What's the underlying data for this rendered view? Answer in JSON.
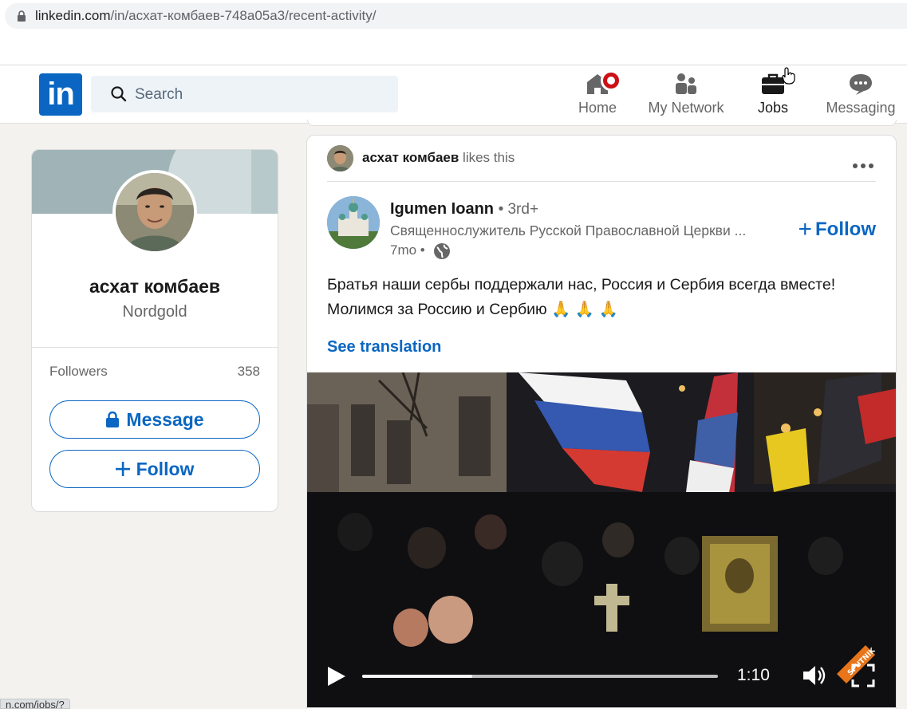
{
  "browser": {
    "url_host": "linkedin.com",
    "url_path": "/in/асхат-комбаев-748a05a3/recent-activity/",
    "status_bar_url": "n.com/jobs/?"
  },
  "navbar": {
    "logo": "in",
    "search_placeholder": "Search",
    "items": [
      {
        "label": "Home",
        "icon": "home-icon"
      },
      {
        "label": "My Network",
        "icon": "network-icon"
      },
      {
        "label": "Jobs",
        "icon": "briefcase-icon"
      },
      {
        "label": "Messaging",
        "icon": "messaging-icon"
      }
    ]
  },
  "profile": {
    "name": "асхат комбаев",
    "company": "Nordgold",
    "followers_label": "Followers",
    "followers_count": "358",
    "message_button": "Message",
    "follow_button": "Follow"
  },
  "post": {
    "liker_name": "асхат комбаев",
    "likes_text": "likes this",
    "author_name": "Igumen Ioann",
    "author_degree": "• 3rd+",
    "author_headline": "Священнослужитель Русской Православной Церкви ...",
    "time": "7mo •",
    "follow_label": "Follow",
    "text": "Братья наши сербы поддержали нас, Россия и Сербия всегда вместе! Молимся за Россию и Сербию 🙏 🙏 🙏",
    "see_translation": "See translation",
    "video": {
      "duration": "1:10",
      "buffered_fraction": 0.31,
      "watermark": "SPUTNIK"
    }
  },
  "colors": {
    "brand": "#0a66c2",
    "notification": "#cc1016",
    "page_bg": "#f3f2ef"
  }
}
